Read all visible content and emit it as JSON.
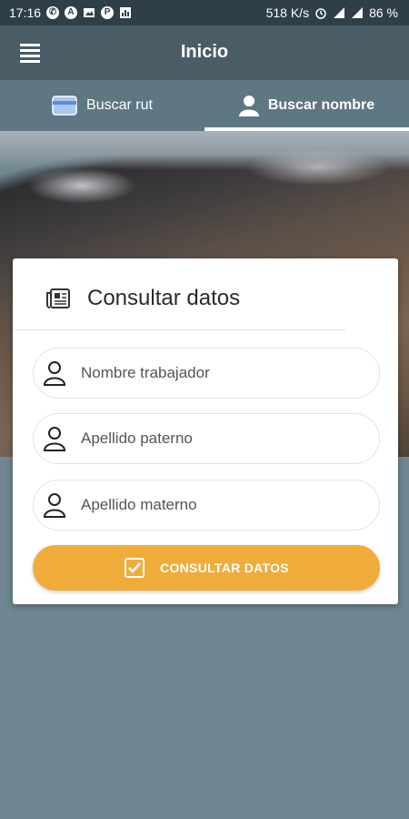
{
  "status_bar": {
    "time": "17:16",
    "net_speed": "518 K/s",
    "battery": "86 %"
  },
  "app_bar": {
    "title": "Inicio"
  },
  "tabs": [
    {
      "label": "Buscar rut",
      "icon": "card-icon",
      "active": false
    },
    {
      "label": "Buscar nombre",
      "icon": "person-icon",
      "active": true
    }
  ],
  "card": {
    "title": "Consultar datos",
    "fields": [
      {
        "placeholder": "Nombre trabajador"
      },
      {
        "placeholder": "Apellido paterno"
      },
      {
        "placeholder": "Apellido materno"
      }
    ],
    "submit_label": "CONSULTAR DATOS"
  },
  "colors": {
    "app_bar": "#4a5c65",
    "tabs": "#5f7782",
    "background": "#6f8790",
    "accent": "#f0ac3b"
  }
}
